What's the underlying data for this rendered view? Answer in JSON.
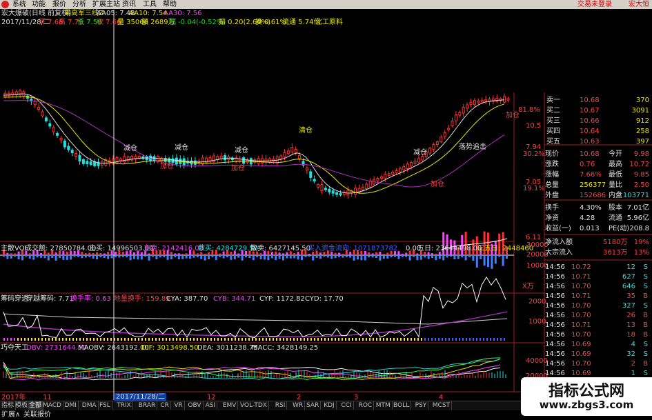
{
  "menu": {
    "items": [
      "系统",
      "功能",
      "报价",
      "分析",
      "扩展主站",
      "资讯",
      "工具",
      "帮助"
    ],
    "login": "交易未登录",
    "brand": "宏大恒"
  },
  "chart_header": {
    "title": "宏大爆破(日线 前复权)",
    "indicator": "乘高军三线Z",
    "ma5": "AA05: 7.48",
    "ma10": "AA10: 7.54",
    "ma30": "AA30: 7.56",
    "date": "2017/11/28/二",
    "open": "开 7.68",
    "high": "高 7.79",
    "low": "低 7.59",
    "close": "收 7.66",
    "volume": "量 35066",
    "amount": "额 2689万",
    "change": "幅 -0.04(-0.52%)",
    "amplitude": "振 0.20(2.60%)",
    "turnover": "换 0.61%",
    "float_cap": "流通 5.74亿",
    "sector": "化工原料"
  },
  "annotations": {
    "qingcang": "清仓",
    "jiancang": "减仓",
    "jiacang": "加仓",
    "luoshi": "落势追击"
  },
  "price_axis": [
    "81.8%",
    "10.5",
    "7.94",
    "30.2%",
    "7.05",
    "19.1%",
    "6.11"
  ],
  "vol_panel": {
    "title": "主散VOL",
    "deal": "成交额: 27850784.00",
    "zhumai": "主买: 14996503.00",
    "zhumai2": "主卖: 2142416.00",
    "sanmai": "散买: 4284729.50",
    "sanmai2": "散卖: 6427145.50",
    "inst": "买入资金流向: 1071873782",
    "zero": "0.00",
    "wuri": "五日: 23644498.00",
    "sanwuri": "三五日: 2448460",
    "axis": [
      "30000",
      "20000",
      "10000"
    ],
    "unit": "X万"
  },
  "chip_panel": {
    "title": "筹码穿透",
    "cross": "穿越筹码: 7.71",
    "huanshou": "换手率: 0.63",
    "dtbhs": "地量换手: 159.89",
    "cya": "CYA: 387.70",
    "cyb": "CYB: 344.71",
    "cyf": "CYF: 1172.82",
    "cyd": "CYD: 17.70",
    "axis": [
      "2000",
      "1000"
    ]
  },
  "obv_panel": {
    "title": "巧夺天工",
    "obv": "OBV: 2731644.50",
    "maobv": "MAOBV: 2643192.00",
    "dif": "DIF: 3013498.50",
    "dea": "DEA: 3011238.75",
    "macc": "MACC: 3428149.25",
    "axis": [
      "40000",
      "20000"
    ]
  },
  "time_axis": [
    "2017年",
    "11",
    "12",
    "2",
    "3",
    "4"
  ],
  "cursor_date": "2017/11/28/二",
  "order_book": [
    {
      "label": "卖一",
      "price": "10.68",
      "vol": "370"
    },
    {
      "label": "买二",
      "price": "10.67",
      "vol": "3091"
    },
    {
      "label": "买三",
      "price": "10.66",
      "vol": "912"
    },
    {
      "label": "买四",
      "price": "10.64",
      "vol": "258"
    },
    {
      "label": "买五",
      "price": "10.63",
      "vol": "397"
    }
  ],
  "quote": [
    {
      "l1": "现价",
      "v1": "10.68",
      "l2": "今开",
      "v2": "9.98"
    },
    {
      "l1": "涨跌",
      "v1": "0.76",
      "l2": "最高",
      "v2": "10.72"
    },
    {
      "l1": "涨幅",
      "v1": "7.66%",
      "l2": "最低",
      "v2": "9.85"
    },
    {
      "l1": "总量",
      "v1": "256377",
      "l2": "量比",
      "v2": "2.50"
    },
    {
      "l1": "外盘",
      "v1": "152686",
      "l2": "内盘",
      "v2": "103771"
    },
    {
      "l1": "换手",
      "v1": "4.30%",
      "l2": "股本",
      "v2": "7.01亿"
    },
    {
      "l1": "净资",
      "v1": "4.28",
      "l2": "流通",
      "v2": "5.96亿"
    },
    {
      "l1": "收益(一)",
      "v1": "0.013",
      "l2": "PE(动)",
      "v2": "208.8"
    }
  ],
  "flow": [
    {
      "label": "净流入额",
      "value": "5180万",
      "pct": "19%"
    },
    {
      "label": "大宗流入",
      "value": "3613万",
      "pct": "13%"
    }
  ],
  "ticks": [
    {
      "t": "14:56",
      "p": "10.72",
      "v": "12",
      "s": "S"
    },
    {
      "t": "14:56",
      "p": "10.71",
      "v": "627",
      "s": "S"
    },
    {
      "t": "14:56",
      "p": "10.70",
      "v": "646",
      "s": "S"
    },
    {
      "t": "14:56",
      "p": "10.71",
      "v": "35",
      "s": "B"
    },
    {
      "t": "14:56",
      "p": "10.70",
      "v": "327",
      "s": "S"
    },
    {
      "t": "14:56",
      "p": "10.70",
      "v": "26",
      "s": "B"
    },
    {
      "t": "14:56",
      "p": "10.71",
      "v": "13",
      "s": "B"
    },
    {
      "t": "14:56",
      "p": "10.70",
      "v": "18",
      "s": "B"
    },
    {
      "t": "14:56",
      "p": "10.69",
      "v": "4",
      "s": "S"
    },
    {
      "t": "14:56",
      "p": "10.69",
      "v": "32",
      "s": "S"
    },
    {
      "t": "14:56",
      "p": "10.70",
      "v": "2",
      "s": "B"
    },
    {
      "t": "14:56",
      "p": "10.69",
      "v": "1",
      "s": "S"
    },
    {
      "t": "14:56",
      "p": "10.70",
      "v": "111",
      "s": "B"
    },
    {
      "t": "14:56",
      "p": "10.69",
      "v": "246",
      "s": "S"
    }
  ],
  "tabs": [
    "指标",
    "模板",
    "全部",
    "MACD",
    "DMI",
    "DMA",
    "FSL",
    "TRIX",
    "BRAR",
    "CR",
    "VR",
    "OBV",
    "ASI",
    "EMV",
    "VOL-TDX",
    "RSI",
    "WR",
    "SAR",
    "KDJ",
    "CCI",
    "ROC",
    "MTM",
    "BOLL",
    "PSY",
    "MCST"
  ],
  "status": {
    "left": "扩展∧",
    "right": "关联报价"
  },
  "watermark": {
    "title": "指标公式网",
    "url": "www.zbgs3.com"
  },
  "colors": {
    "up": "#ff3030",
    "down": "#20e0e0",
    "ma5": "#e0e0e0",
    "ma30": "#b030c0",
    "background": "#000000"
  }
}
